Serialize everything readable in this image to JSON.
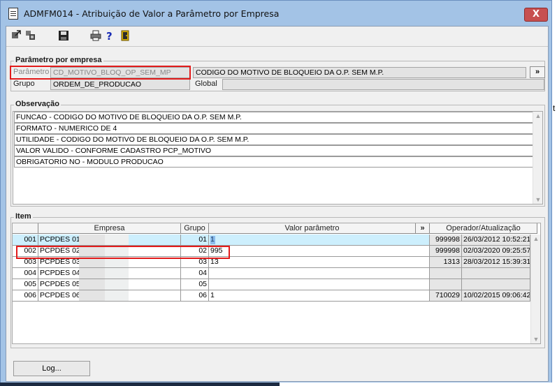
{
  "window": {
    "title": "ADMFM014 - Atribuição de Valor a Parâmetro por Empresa",
    "close_label": "X"
  },
  "toolbar": {
    "icons": [
      "arrow-out-icon",
      "window-tile-icon",
      "save-icon",
      "print-icon",
      "help-icon",
      "exit-door-icon"
    ]
  },
  "parametro": {
    "group_title": "Parâmetro por empresa",
    "parametro_label": "Parâmetro",
    "parametro_value": "CD_MOTIVO_BLOQ_OP_SEM_MP",
    "descricao_value": "CODIGO DO MOTIVO DE BLOQUEIO DA O.P. SEM M.P.",
    "expand_label": "»",
    "grupo_label": "Grupo",
    "grupo_value": "ORDEM_DE_PRODUCAO",
    "global_label": "Global",
    "global_value": ""
  },
  "observacao": {
    "group_title": "Observação",
    "lines": [
      "FUNCAO - CODIGO DO MOTIVO DE BLOQUEIO DA O.P. SEM M.P.",
      "FORMATO - NUMERICO DE 4",
      "UTILIDADE - CODIGO DO MOTIVO DE BLOQUEIO DA O.P. SEM M.P.",
      "VALOR VALIDO - CONFORME CADASTRO PCP_MOTIVO",
      "OBRIGATORIO NO - MODULO PRODUCAO"
    ]
  },
  "item": {
    "group_title": "Item",
    "headers": {
      "empresa": "Empresa",
      "grupo": "Grupo",
      "valor": "Valor parâmetro",
      "expand": "»",
      "operador": "Operador/Atualização"
    },
    "rows": [
      {
        "num": "001",
        "empresa": "PCPDES 01",
        "grupo": "01",
        "valor": "1",
        "operador": "999998",
        "data": "26/03/2012 10:52:21"
      },
      {
        "num": "002",
        "empresa": "PCPDES 02",
        "grupo": "02",
        "valor": "995",
        "operador": "999998",
        "data": "02/03/2020 09:25:57"
      },
      {
        "num": "003",
        "empresa": "PCPDES 03",
        "grupo": "03",
        "valor": "13",
        "operador": "1313",
        "data": "28/03/2012 15:39:31"
      },
      {
        "num": "004",
        "empresa": "PCPDES 04",
        "grupo": "04",
        "valor": "",
        "operador": "",
        "data": ""
      },
      {
        "num": "005",
        "empresa": "PCPDES 05",
        "grupo": "05",
        "valor": "",
        "operador": "",
        "data": ""
      },
      {
        "num": "006",
        "empresa": "PCPDES 06",
        "grupo": "06",
        "valor": "1",
        "operador": "710029",
        "data": "10/02/2015 09:06:42"
      }
    ]
  },
  "footer": {
    "log_label": "Log..."
  },
  "background": {
    "stray_char": "t"
  },
  "colors": {
    "titlebar": "#a3c3e6",
    "close_button": "#c75050",
    "highlight_box": "#e21b1b",
    "selected_cell": "#cdeffd"
  }
}
